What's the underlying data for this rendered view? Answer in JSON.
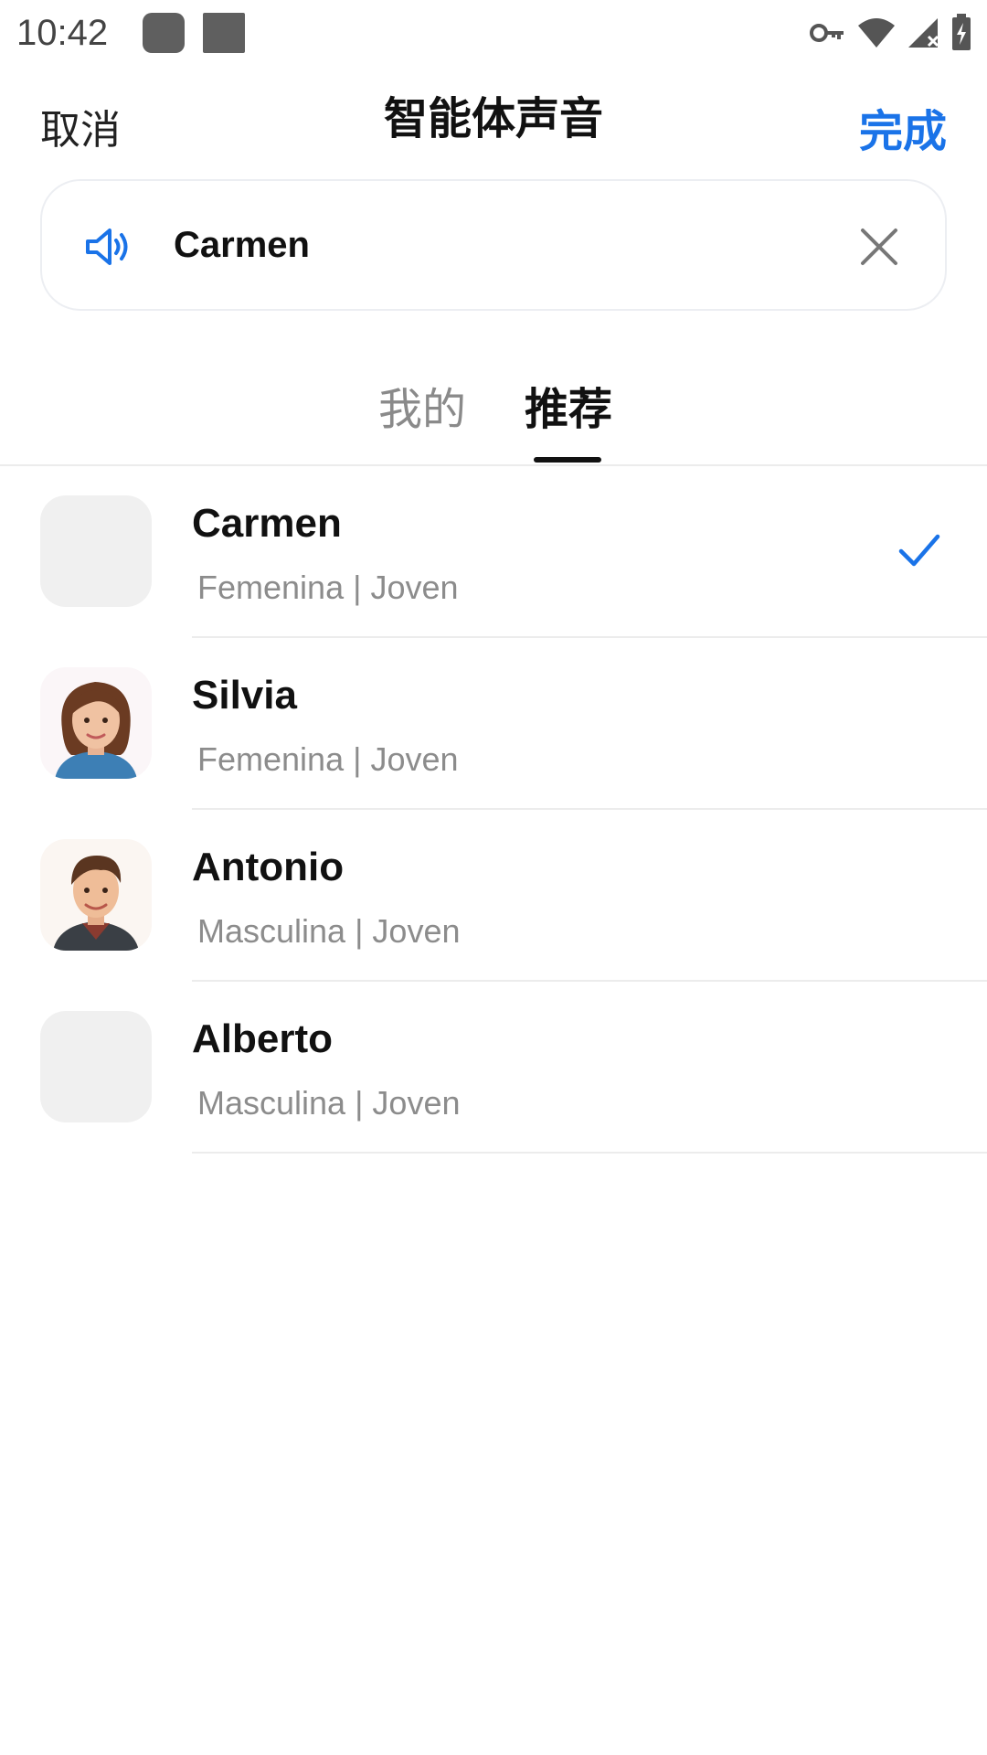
{
  "status_bar": {
    "time": "10:42",
    "icons": [
      "app-notification-icon",
      "app-notification-icon",
      "vpn-key-icon",
      "wifi-icon",
      "cellular-signal-icon",
      "battery-charging-icon"
    ]
  },
  "header": {
    "cancel_label": "取消",
    "title": "智能体声音",
    "done_label": "完成"
  },
  "selected_voice": {
    "name": "Carmen",
    "icon": "speaker-icon",
    "clear_icon": "close-icon"
  },
  "tabs": [
    {
      "label": "我的",
      "active": false
    },
    {
      "label": "推荐",
      "active": true
    }
  ],
  "voices": [
    {
      "name": "Carmen",
      "meta": "Femenina | Joven",
      "avatar": "empty",
      "selected": true
    },
    {
      "name": "Silvia",
      "meta": "Femenina | Joven",
      "avatar": "woman-avatar",
      "selected": false
    },
    {
      "name": "Antonio",
      "meta": "Masculina | Joven",
      "avatar": "man-avatar",
      "selected": false
    },
    {
      "name": "Alberto",
      "meta": "Masculina | Joven",
      "avatar": "empty",
      "selected": false
    }
  ],
  "colors": {
    "accent": "#1a73e8",
    "text_primary": "#111111",
    "text_secondary": "#8c8c8c",
    "divider": "#ececec",
    "placeholder": "#f0f0f0"
  }
}
